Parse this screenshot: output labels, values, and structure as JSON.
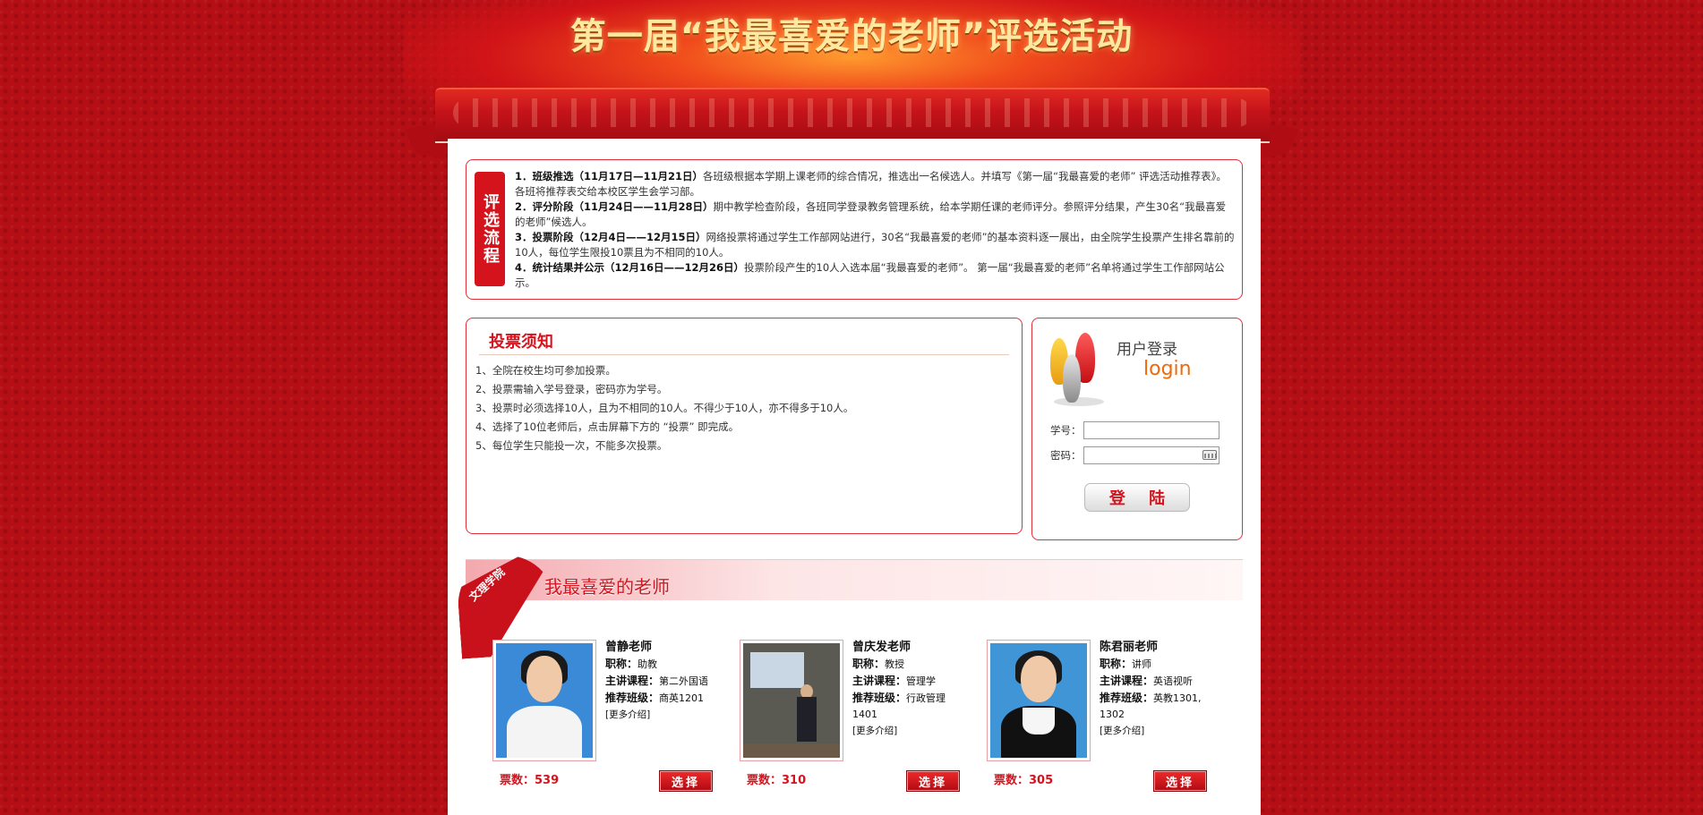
{
  "banner": {
    "title": "第一届“我最喜爱的老师”评选活动"
  },
  "process": {
    "label": "评选流程",
    "steps": [
      {
        "head": "1．班级推选（11月17日—11月21日）",
        "text": "各班级根据本学期上课老师的综合情况，推选出一名候选人。并填写《第一届“我最喜爱的老师” 评选活动推荐表》。各班将推荐表交给本校区学生会学习部。"
      },
      {
        "head": "2．评分阶段（11月24日——11月28日）",
        "text": "期中教学检查阶段，各班同学登录教务管理系统，给本学期任课的老师评分。参照评分结果，产生30名“我最喜爱的老师”候选人。"
      },
      {
        "head": "3．投票阶段（12月4日——12月15日）",
        "text": "网络投票将通过学生工作部网站进行，30名“我最喜爱的老师”的基本资料逐一展出，由全院学生投票产生排名靠前的10人，每位学生限投10票且为不相同的10人。"
      },
      {
        "head": "4．统计结果并公示（12月16日——12月26日）",
        "text": "投票阶段产生的10人入选本届“我最喜爱的老师”。 第一届“我最喜爱的老师”名单将通过学生工作部网站公示。"
      }
    ]
  },
  "notice": {
    "title": "投票须知",
    "items": [
      "1、全院在校生均可参加投票。",
      "2、投票需输入学号登录，密码亦为学号。",
      "3、投票时必须选择10人，且为不相同的10人。不得少于10人，亦不得多于10人。",
      "4、选择了10位老师后，点击屏幕下方的 “投票” 即完成。",
      "5、每位学生只能投一次，不能多次投票。"
    ]
  },
  "login": {
    "title": "用户登录",
    "subtitle": "login",
    "username_label": "学号：",
    "username_value": "",
    "password_label": "密码：",
    "password_value": "",
    "button_label": "登 陆"
  },
  "favorites": {
    "badge": "文理学院",
    "title": "我最喜爱的老师",
    "teachers": [
      {
        "name": "曾静老师",
        "title_label": "职称：",
        "title": "助教",
        "course_label": "主讲课程：",
        "course": "第二外国语",
        "class_label": "推荐班级：",
        "class": "商英1201",
        "more": "[更多介绍]",
        "votes": "票数：539",
        "select_label": "选择"
      },
      {
        "name": "曾庆发老师",
        "title_label": "职称：",
        "title": "教授",
        "course_label": "主讲课程：",
        "course": "管理学",
        "class_label": "推荐班级：",
        "class": "行政管理1401",
        "more": "[更多介绍]",
        "votes": "票数：310",
        "select_label": "选择"
      },
      {
        "name": "陈君丽老师",
        "title_label": "职称：",
        "title": "讲师",
        "course_label": "主讲课程：",
        "course": "英语视听",
        "class_label": "推荐班级：",
        "class": "英教1301, 1302",
        "more": "[更多介绍]",
        "votes": "票数：305",
        "select_label": "选择"
      }
    ]
  }
}
